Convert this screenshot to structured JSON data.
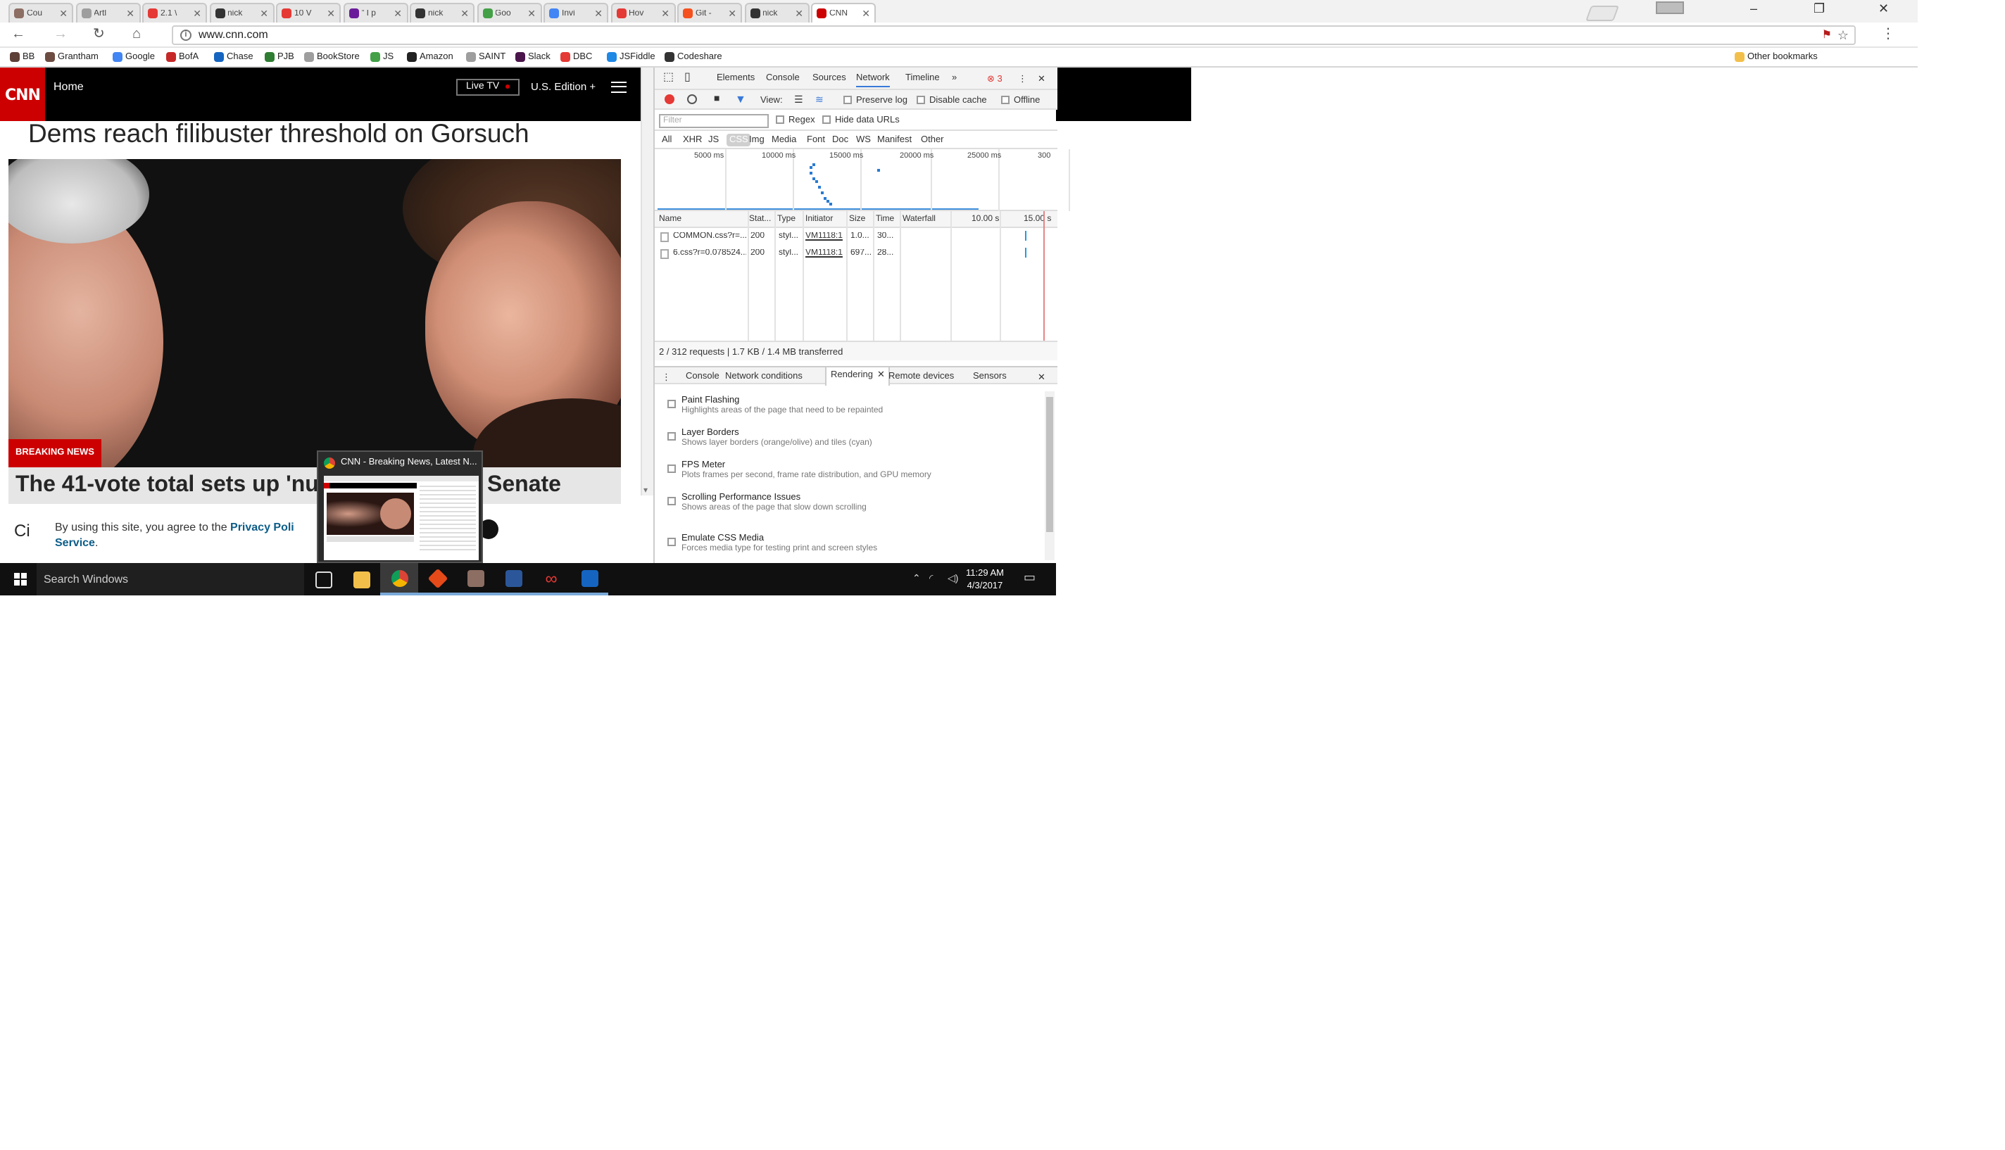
{
  "browser": {
    "tabs": [
      {
        "title": "Cou",
        "favicon_color": "#8d6e63",
        "active": false
      },
      {
        "title": "Artl",
        "favicon_color": "#9e9e9e",
        "active": false
      },
      {
        "title": "2.1 \\",
        "favicon_color": "#e53935",
        "active": false
      },
      {
        "title": "nick",
        "favicon_color": "#333333",
        "active": false
      },
      {
        "title": "10 V",
        "favicon_color": "#e53935",
        "active": false
      },
      {
        "title": "\" I p",
        "favicon_color": "#6a1b9a",
        "active": false
      },
      {
        "title": "nick",
        "favicon_color": "#333333",
        "active": false
      },
      {
        "title": "Goo",
        "favicon_color": "#43a047",
        "active": false
      },
      {
        "title": "Invi",
        "favicon_color": "#4285f4",
        "active": false
      },
      {
        "title": "Hov",
        "favicon_color": "#e53935",
        "active": false
      },
      {
        "title": "Git -",
        "favicon_color": "#f4511e",
        "active": false
      },
      {
        "title": "nick",
        "favicon_color": "#333333",
        "active": false
      },
      {
        "title": "CNN",
        "favicon_color": "#cc0000",
        "active": true
      }
    ],
    "url": "www.cnn.com",
    "bookmarks": [
      {
        "label": "BB",
        "color": "#5d4037"
      },
      {
        "label": "Grantham",
        "color": "#6d4c41"
      },
      {
        "label": "Google",
        "color": "#4285f4"
      },
      {
        "label": "BofA",
        "color": "#c62828"
      },
      {
        "label": "Chase",
        "color": "#1565c0"
      },
      {
        "label": "PJB",
        "color": "#2e7d32"
      },
      {
        "label": "BookStore",
        "color": "#9e9e9e"
      },
      {
        "label": "JS",
        "color": "#43a047"
      },
      {
        "label": "Amazon",
        "color": "#222222"
      },
      {
        "label": "SAINT",
        "color": "#9e9e9e"
      },
      {
        "label": "Slack",
        "color": "#4a154b"
      },
      {
        "label": "DBC",
        "color": "#e53935"
      },
      {
        "label": "JSFiddle",
        "color": "#1e88e5"
      },
      {
        "label": "Codeshare",
        "color": "#333333"
      }
    ],
    "other_bookmarks": "Other bookmarks"
  },
  "cnn": {
    "logo": "CNN",
    "home": "Home",
    "live_tv": "Live TV",
    "edition": "U.S. Edition +",
    "headline": "Dems reach filibuster threshold on Gorsuch",
    "breaking": "BREAKING NEWS",
    "story_left": "The 41-vote total sets up 'nu",
    "story_right": "Senate",
    "cut_text": "Ci",
    "cookie": {
      "text": "By using this site, you agree to the ",
      "link1": "Privacy Poli",
      "link2": "Service",
      "end": "."
    }
  },
  "devtools": {
    "tabs": [
      "Elements",
      "Console",
      "Sources",
      "Network",
      "Timeline"
    ],
    "active_tab": "Network",
    "more": "»",
    "error_count": "3",
    "toolbar": {
      "view": "View:",
      "preserve_log": "Preserve log",
      "disable_cache": "Disable cache",
      "offline": "Offline"
    },
    "filter_placeholder": "Filter",
    "regex": "Regex",
    "hide_data_urls": "Hide data URLs",
    "types": [
      "All",
      "XHR",
      "JS",
      "CSS",
      "Img",
      "Media",
      "Font",
      "Doc",
      "WS",
      "Manifest",
      "Other"
    ],
    "active_type": "CSS",
    "overview_ticks": [
      "5000 ms",
      "10000 ms",
      "15000 ms",
      "20000 ms",
      "25000 ms",
      "300"
    ],
    "columns": [
      "Name",
      "Stat...",
      "Type",
      "Initiator",
      "Size",
      "Time",
      "Waterfall",
      "10.00 s",
      "15.00 s"
    ],
    "rows": [
      {
        "name": "COMMON.css?r=...",
        "status": "200",
        "type": "styl...",
        "initiator": "VM1118:1",
        "size": "1.0...",
        "time": "30..."
      },
      {
        "name": "6.css?r=0.078524...",
        "status": "200",
        "type": "styl...",
        "initiator": "VM1118:1",
        "size": "697...",
        "time": "28..."
      }
    ],
    "summary": "2 / 312 requests  |  1.7 KB / 1.4 MB transferred",
    "drawer_tabs": [
      "Console",
      "Network conditions",
      "Rendering",
      "Remote devices",
      "Sensors"
    ],
    "drawer_active": "Rendering",
    "rendering": [
      {
        "title": "Paint Flashing",
        "desc": "Highlights areas of the page that need to be repainted"
      },
      {
        "title": "Layer Borders",
        "desc": "Shows layer borders (orange/olive) and tiles (cyan)"
      },
      {
        "title": "FPS Meter",
        "desc": "Plots frames per second, frame rate distribution, and GPU memory"
      },
      {
        "title": "Scrolling Performance Issues",
        "desc": "Shows areas of the page that slow down scrolling"
      },
      {
        "title": "Emulate CSS Media",
        "desc": "Forces media type for testing print and screen styles"
      }
    ]
  },
  "preview": {
    "title": "CNN - Breaking News, Latest N..."
  },
  "taskbar": {
    "search": "Search Windows",
    "time": "11:29 AM",
    "date": "4/3/2017",
    "apps": [
      "task-view",
      "file-explorer",
      "chrome",
      "git",
      "photo-app",
      "word",
      "app-infinity",
      "aws-app"
    ]
  }
}
